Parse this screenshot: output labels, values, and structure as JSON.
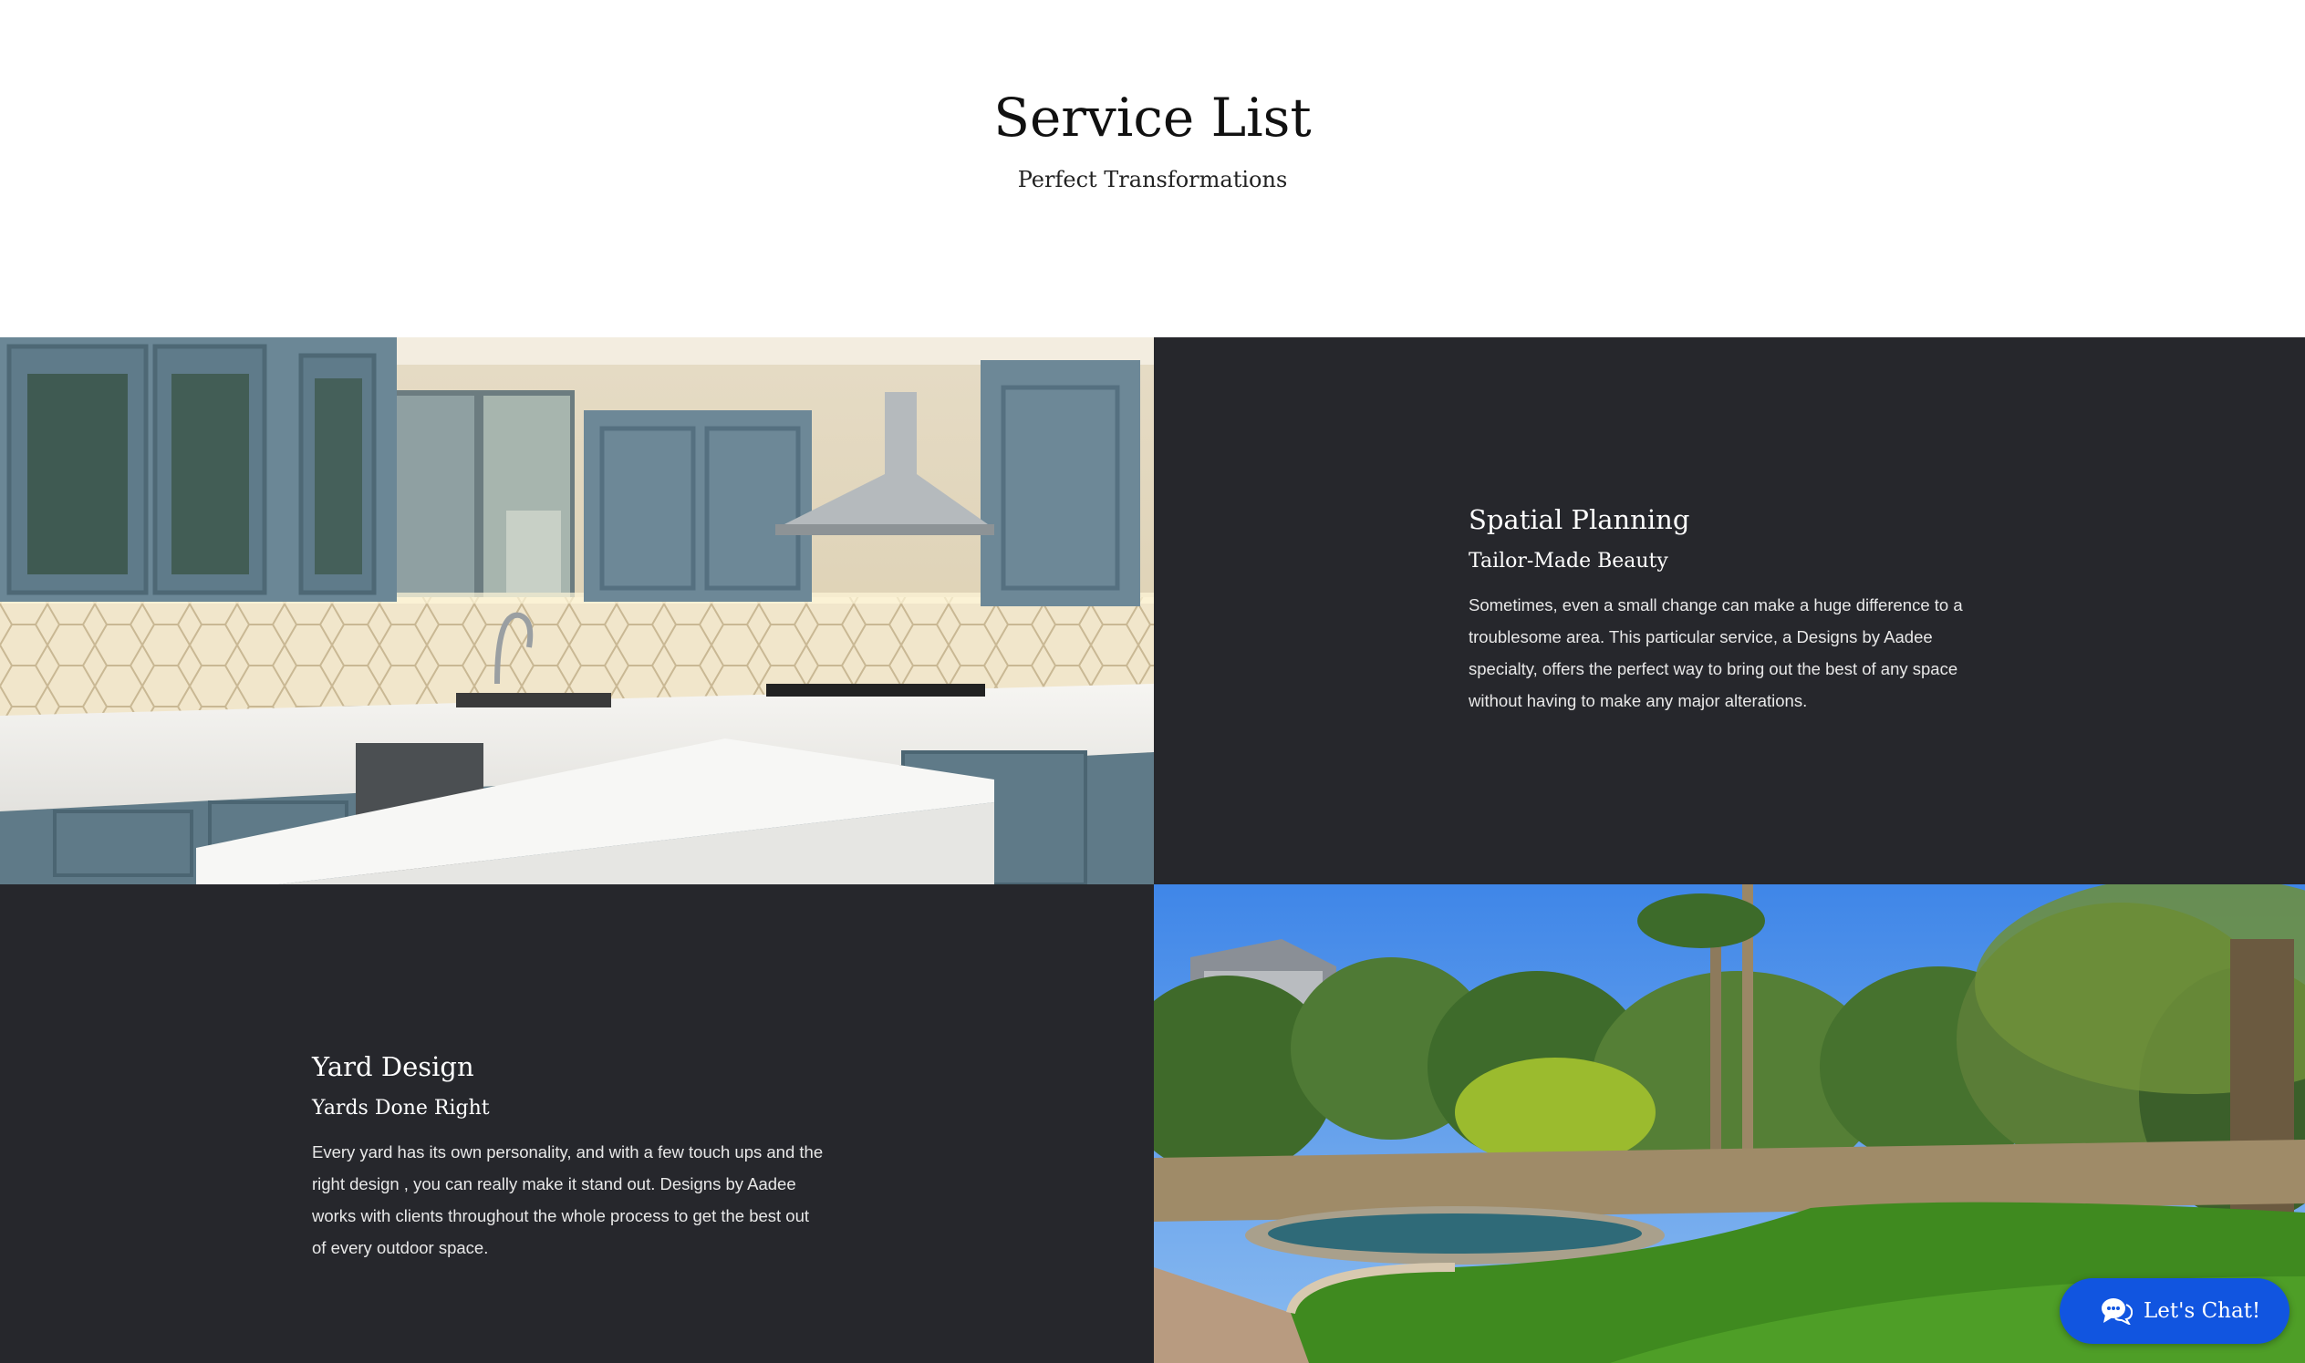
{
  "header": {
    "title": "Service List",
    "subtitle": "Perfect Transformations"
  },
  "services": [
    {
      "title": "Spatial Planning",
      "tagline": "Tailor-Made Beauty",
      "description_lines": [
        "Sometimes, even a small change can make a huge difference to a",
        "troublesome area. This particular service, a Designs by Aadee",
        "specialty, offers the perfect way to bring out the best of any space",
        "without having to make any major alterations."
      ]
    },
    {
      "title": "Yard Design",
      "tagline": "Yards Done Right",
      "description_lines": [
        "Every yard has its own personality, and with a few touch ups and the",
        "right design , you can really make it stand out. Designs by Aadee",
        "works with clients throughout the whole process to get the best out",
        "of every outdoor space."
      ]
    }
  ],
  "chat": {
    "label": "Let's Chat!",
    "icon": "chat-bubbles-icon"
  },
  "colors": {
    "dark_panel": "#26272c",
    "chat_blue": "#1155e0"
  }
}
